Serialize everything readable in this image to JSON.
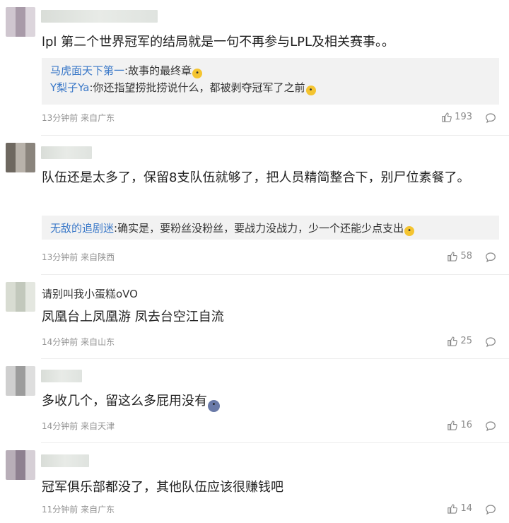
{
  "comments": [
    {
      "text": "lpl 第二个世界冠军的结局就是一句不再参与LPL及相关赛事。。",
      "replies": [
        {
          "name": "马虎面天下第一",
          "text": ":故事的最终章",
          "emoji": "😭"
        },
        {
          "name": "Y梨子Ya",
          "text": ":你还指望捞批捞说什么，都被剥夺冠军了之前",
          "emoji": "🤭"
        }
      ],
      "time": "13分钟前",
      "location": "来自广东",
      "likes": "193"
    },
    {
      "text": "队伍还是太多了，保留8支队伍就够了，把人员精简整合下，别尸位素餐了。",
      "replies": [
        {
          "name": "无敌的追剧迷",
          "text": ":确实是，要粉丝没粉丝，要战力没战力，少一个还能少点支出",
          "emoji": "🤭"
        }
      ],
      "time": "13分钟前",
      "location": "来自陕西",
      "likes": "58"
    },
    {
      "username": "请别叫我小蛋糕oVO",
      "text": "凤凰台上凤凰游 凤去台空江自流",
      "time": "14分钟前",
      "location": "来自山东",
      "likes": "25"
    },
    {
      "text": "多收几个，留这么多屁用没有",
      "emoji": "😱",
      "time": "14分钟前",
      "location": "来自天津",
      "likes": "16"
    },
    {
      "text": "冠军俱乐部都没了，其他队伍应该很赚钱吧",
      "time": "11分钟前",
      "location": "来自广东",
      "likes": "14"
    }
  ],
  "colors": {
    "link": "#3a78c8",
    "meta": "#939393",
    "reply_bg": "#f2f2f2"
  },
  "icons": {
    "like": "thumbs-up-icon",
    "reply": "speech-bubble-icon"
  }
}
